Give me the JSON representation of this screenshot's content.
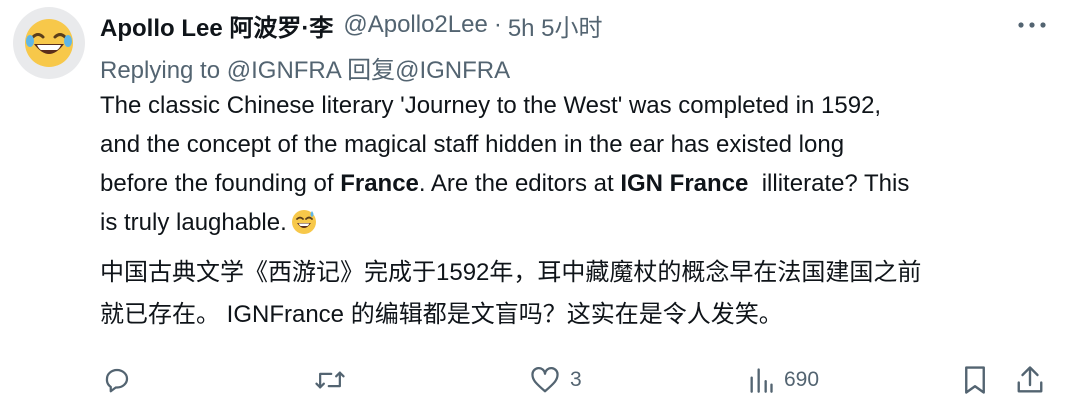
{
  "author": {
    "name": "Apollo Lee 阿波罗·李",
    "handle": "@Apollo2Lee",
    "separator": "·",
    "time": "5h 5小时"
  },
  "replying_to": "Replying to @IGNFRA 回复@IGNFRA",
  "body_en": {
    "line1": "The classic Chinese literary 'Journey to the West' was completed in 1592,",
    "line2": "and the concept of the magical staff hidden in the ear has existed long",
    "line3_a": "before the founding of ",
    "line3_b": "France",
    "line3_c": ". Are the editors at ",
    "line3_d": "IGN France",
    "line3_e": "  illiterate? This",
    "line4": "is truly laughable."
  },
  "body_zh": {
    "line1": "中国古典文学《西游记》完成于1592年，耳中藏魔杖的概念早在法国建国之前",
    "line2": "就已存在。 IGNFrance 的编辑都是文盲吗？这实在是令人发笑。"
  },
  "actions": {
    "reply_count": "",
    "retweet_count": "",
    "like_count": "3",
    "views_count": "690"
  },
  "icons": {
    "avatar": "laughing-face-emoji",
    "inline_emoji": "sweat-smile-emoji",
    "more": "more-horizontal-icon",
    "reply": "reply-bubble-icon",
    "retweet": "retweet-icon",
    "like": "heart-icon",
    "views": "views-bar-chart-icon",
    "bookmark": "bookmark-icon",
    "share": "share-icon"
  },
  "colors": {
    "text": "#0f1419",
    "secondary": "#536471",
    "emoji_yellow": "#f7c84a"
  }
}
